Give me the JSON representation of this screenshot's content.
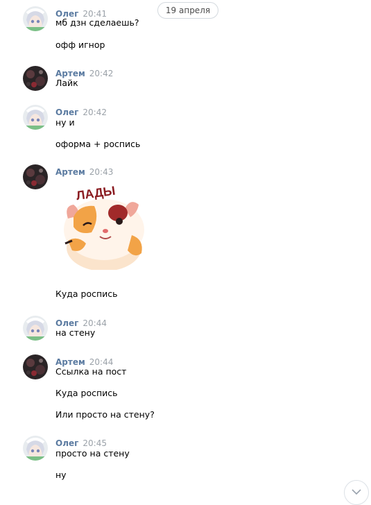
{
  "date_separator": "19 апреля",
  "messages": [
    {
      "author": "Олег",
      "time": "20:41",
      "avatar": "anime-avatar",
      "lines": [
        "мб дзн сделаешь?",
        "офф игнор"
      ]
    },
    {
      "author": "Артем",
      "time": "20:42",
      "avatar": "dark-avatar",
      "lines": [
        "Лайк"
      ]
    },
    {
      "author": "Олег",
      "time": "20:42",
      "avatar": "anime-avatar",
      "lines": [
        "ну и",
        "оформа + роспись"
      ]
    },
    {
      "author": "Артем",
      "time": "20:43",
      "avatar": "dark-avatar",
      "sticker": {
        "name": "hamster-sticker",
        "caption": "ЛАДЫ"
      },
      "lines": [
        "Куда роспись"
      ]
    },
    {
      "author": "Олег",
      "time": "20:44",
      "avatar": "anime-avatar",
      "lines": [
        "на стену"
      ]
    },
    {
      "author": "Артем",
      "time": "20:44",
      "avatar": "dark-avatar",
      "lines": [
        "Ссылка на пост",
        "Куда роспись",
        "Или просто на стену?"
      ]
    },
    {
      "author": "Олег",
      "time": "20:45",
      "avatar": "anime-avatar",
      "lines": [
        "просто на стену",
        "ну"
      ]
    }
  ],
  "scroll_button": {
    "icon": "chevron-down-icon"
  },
  "colors": {
    "author": "#5b7ba1",
    "time": "#9aa1a8",
    "pill_border": "#d3d9de"
  }
}
